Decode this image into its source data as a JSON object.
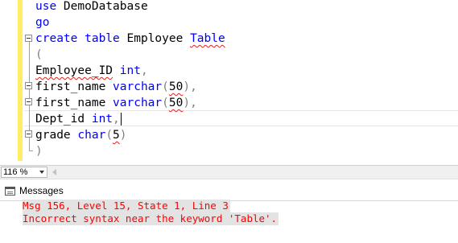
{
  "editor": {
    "lines": [
      {
        "parts": [
          {
            "t": "use ",
            "c": "kw"
          },
          {
            "t": "DemoDatabase",
            "c": "tx"
          }
        ]
      },
      {
        "parts": [
          {
            "t": "go",
            "c": "kw"
          }
        ]
      },
      {
        "parts": [
          {
            "t": "create table ",
            "c": "kw"
          },
          {
            "t": "Employee ",
            "c": "tx"
          },
          {
            "t": "Table",
            "c": "kw squig"
          }
        ]
      },
      {
        "parts": [
          {
            "t": "(",
            "c": "pn"
          }
        ]
      },
      {
        "parts": [
          {
            "t": "Employee_ID",
            "c": "tx squig"
          },
          {
            "t": " int",
            "c": "kw"
          },
          {
            "t": ",",
            "c": "pn"
          }
        ]
      },
      {
        "parts": [
          {
            "t": "first_name ",
            "c": "tx"
          },
          {
            "t": "varchar",
            "c": "kw"
          },
          {
            "t": "(",
            "c": "pn"
          },
          {
            "t": "50",
            "c": "tx squig"
          },
          {
            "t": "),",
            "c": "pn"
          }
        ]
      },
      {
        "parts": [
          {
            "t": "first_name ",
            "c": "tx"
          },
          {
            "t": "varchar",
            "c": "kw"
          },
          {
            "t": "(",
            "c": "pn"
          },
          {
            "t": "50",
            "c": "tx squig"
          },
          {
            "t": "),",
            "c": "pn"
          }
        ]
      },
      {
        "parts": [
          {
            "t": "Dept_id ",
            "c": "tx"
          },
          {
            "t": "int",
            "c": "kw"
          },
          {
            "t": ",",
            "c": "pn"
          }
        ]
      },
      {
        "parts": [
          {
            "t": "grade ",
            "c": "tx"
          },
          {
            "t": "char",
            "c": "kw"
          },
          {
            "t": "(",
            "c": "pn"
          },
          {
            "t": "5",
            "c": "tx squig"
          },
          {
            "t": ")",
            "c": "pn"
          }
        ]
      },
      {
        "parts": [
          {
            "t": ")",
            "c": "pn"
          }
        ]
      }
    ]
  },
  "zoom": {
    "value": "116 %"
  },
  "messages": {
    "tab_label": "Messages",
    "lines": [
      "Msg 156, Level 15, State 1, Line 3",
      "Incorrect syntax near the keyword 'Table'."
    ]
  },
  "colors": {
    "keyword": "#0000ff",
    "error_text": "#ff0000",
    "margin_marker": "#ffee62"
  }
}
